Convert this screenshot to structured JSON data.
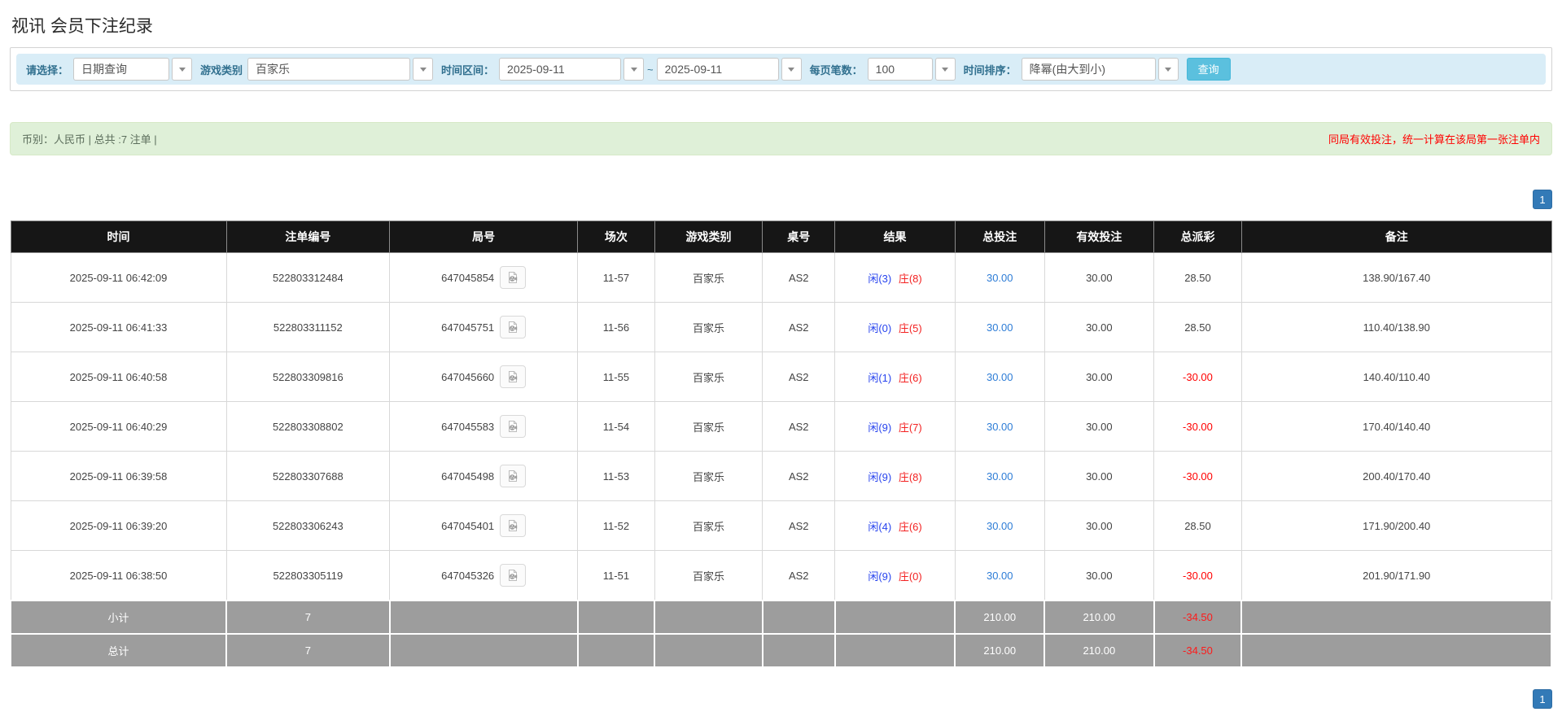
{
  "page": {
    "title": "视讯 会员下注纪录"
  },
  "filters": {
    "select_label": "请选择：",
    "select_value": "日期查询",
    "game_type_label": "游戏类别",
    "game_type_value": "百家乐",
    "time_range_label": "时间区间：",
    "date_from": "2025-09-11",
    "tilde": "~",
    "date_to": "2025-09-11",
    "page_size_label": "每页笔数：",
    "page_size_value": "100",
    "sort_label": "时间排序：",
    "sort_value": "降幂(由大到小)",
    "search_button": "查询"
  },
  "summary": {
    "left": "币别：人民币 | 总共 :7 注单 |",
    "right": "同局有效投注，统一计算在该局第一张注单内"
  },
  "pagination": {
    "page": "1"
  },
  "colors": {
    "accent_blue": "#337ab7",
    "info_bg": "#d9edf7",
    "success_bg": "#dff0d8",
    "player_blue": "#2743ee",
    "banker_red": "#f32222",
    "negative_red": "#ff0000"
  },
  "table": {
    "headers": [
      "时间",
      "注单编号",
      "局号",
      "场次",
      "游戏类别",
      "桌号",
      "结果",
      "总投注",
      "有效投注",
      "总派彩",
      "备注"
    ],
    "rows": [
      {
        "time": "2025-09-11 06:42:09",
        "bet_id": "522803312484",
        "round_id": "647045854",
        "session": "11-57",
        "game": "百家乐",
        "table_no": "AS2",
        "result_player": "闲(3)",
        "result_banker": "庄(8)",
        "total_bet": "30.00",
        "valid_bet": "30.00",
        "payout": "28.50",
        "remark": "138.90/167.40"
      },
      {
        "time": "2025-09-11 06:41:33",
        "bet_id": "522803311152",
        "round_id": "647045751",
        "session": "11-56",
        "game": "百家乐",
        "table_no": "AS2",
        "result_player": "闲(0)",
        "result_banker": "庄(5)",
        "total_bet": "30.00",
        "valid_bet": "30.00",
        "payout": "28.50",
        "remark": "110.40/138.90"
      },
      {
        "time": "2025-09-11 06:40:58",
        "bet_id": "522803309816",
        "round_id": "647045660",
        "session": "11-55",
        "game": "百家乐",
        "table_no": "AS2",
        "result_player": "闲(1)",
        "result_banker": "庄(6)",
        "total_bet": "30.00",
        "valid_bet": "30.00",
        "payout": "-30.00",
        "remark": "140.40/110.40"
      },
      {
        "time": "2025-09-11 06:40:29",
        "bet_id": "522803308802",
        "round_id": "647045583",
        "session": "11-54",
        "game": "百家乐",
        "table_no": "AS2",
        "result_player": "闲(9)",
        "result_banker": "庄(7)",
        "total_bet": "30.00",
        "valid_bet": "30.00",
        "payout": "-30.00",
        "remark": "170.40/140.40"
      },
      {
        "time": "2025-09-11 06:39:58",
        "bet_id": "522803307688",
        "round_id": "647045498",
        "session": "11-53",
        "game": "百家乐",
        "table_no": "AS2",
        "result_player": "闲(9)",
        "result_banker": "庄(8)",
        "total_bet": "30.00",
        "valid_bet": "30.00",
        "payout": "-30.00",
        "remark": "200.40/170.40"
      },
      {
        "time": "2025-09-11 06:39:20",
        "bet_id": "522803306243",
        "round_id": "647045401",
        "session": "11-52",
        "game": "百家乐",
        "table_no": "AS2",
        "result_player": "闲(4)",
        "result_banker": "庄(6)",
        "total_bet": "30.00",
        "valid_bet": "30.00",
        "payout": "28.50",
        "remark": "171.90/200.40"
      },
      {
        "time": "2025-09-11 06:38:50",
        "bet_id": "522803305119",
        "round_id": "647045326",
        "session": "11-51",
        "game": "百家乐",
        "table_no": "AS2",
        "result_player": "闲(9)",
        "result_banker": "庄(0)",
        "total_bet": "30.00",
        "valid_bet": "30.00",
        "payout": "-30.00",
        "remark": "201.90/171.90"
      }
    ],
    "subtotal": {
      "label": "小计",
      "count": "7",
      "total_bet": "210.00",
      "valid_bet": "210.00",
      "payout": "-34.50",
      "remark": ""
    },
    "total": {
      "label": "总计",
      "count": "7",
      "total_bet": "210.00",
      "valid_bet": "210.00",
      "payout": "-34.50",
      "remark": ""
    }
  }
}
